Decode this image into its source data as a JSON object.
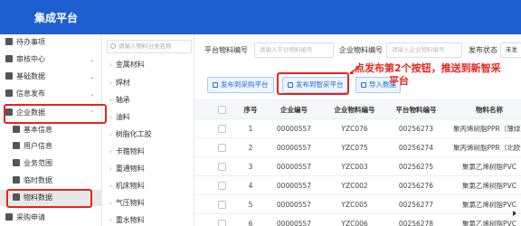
{
  "header": {
    "title": "集成平台"
  },
  "sidebar": {
    "items": [
      {
        "label": "待办事项",
        "icon": "todo-icon",
        "sub": false,
        "expandable": false
      },
      {
        "label": "审核中心",
        "icon": "audit-icon",
        "sub": false,
        "expandable": true
      },
      {
        "label": "基础数据",
        "icon": "database-icon",
        "sub": false,
        "expandable": true
      },
      {
        "label": "信息发布",
        "icon": "publish-icon",
        "sub": false,
        "expandable": true
      },
      {
        "label": "企业数据",
        "icon": "enterprise-icon",
        "sub": false,
        "expandable": true
      },
      {
        "label": "基本信息",
        "icon": "user-icon",
        "sub": true,
        "expandable": false
      },
      {
        "label": "用户信息",
        "icon": "users-icon",
        "sub": true,
        "expandable": false
      },
      {
        "label": "业务范围",
        "icon": "scope-icon",
        "sub": true,
        "expandable": false
      },
      {
        "label": "临时数据",
        "icon": "temp-data-icon",
        "sub": true,
        "expandable": false
      },
      {
        "label": "物料数据",
        "icon": "material-icon",
        "sub": true,
        "expandable": false
      },
      {
        "label": "采购申请",
        "icon": "purchase-icon",
        "sub": false,
        "expandable": false
      }
    ]
  },
  "tree": {
    "search_placeholder": "请输入物料分类名称",
    "items": [
      "金属材料",
      "焊材",
      "轴承",
      "油料",
      "树脂化工胶",
      "卡箍物料",
      "重通物料",
      "机床物料",
      "气压物料",
      "重水物料"
    ]
  },
  "filters": {
    "platform_code_label": "平台物料编号",
    "platform_code_placeholder": "请输入平台物料编号",
    "enterprise_code_label": "企业物料编号",
    "enterprise_code_placeholder": "请输入企业物料编号",
    "status_label": "发布状态",
    "status_value": "未发"
  },
  "toolbar": {
    "publish_purchase": "发布到采购平台",
    "publish_zhicai": "发布到智采平台",
    "third_button": "导入数据"
  },
  "annotation": {
    "line1": "点发布第2个按钮，推送到新智采",
    "line2": "平台"
  },
  "table": {
    "headers": [
      "序号",
      "企业编号",
      "企业物料编号",
      "平台物料编号",
      "物料名称"
    ],
    "rows": [
      [
        "1",
        "00000557",
        "YZC076",
        "00256273",
        "聚丙烯树脂PPR（薄绿）"
      ],
      [
        "2",
        "00000557",
        "YZC075",
        "00256274",
        "聚丙烯树脂PPR（北欧化工）"
      ],
      [
        "3",
        "00000557",
        "YZC003",
        "00256275",
        "聚氯乙烯树脂PVC"
      ],
      [
        "4",
        "00000557",
        "YZC002",
        "00256276",
        "聚氯乙烯树脂PVC"
      ],
      [
        "5",
        "00000557",
        "YZC005",
        "00256277",
        "聚氯乙烯树脂PVC"
      ],
      [
        "6",
        "00000557",
        "YZC006",
        "00256278",
        "聚氯乙烯树脂PVC"
      ]
    ]
  }
}
